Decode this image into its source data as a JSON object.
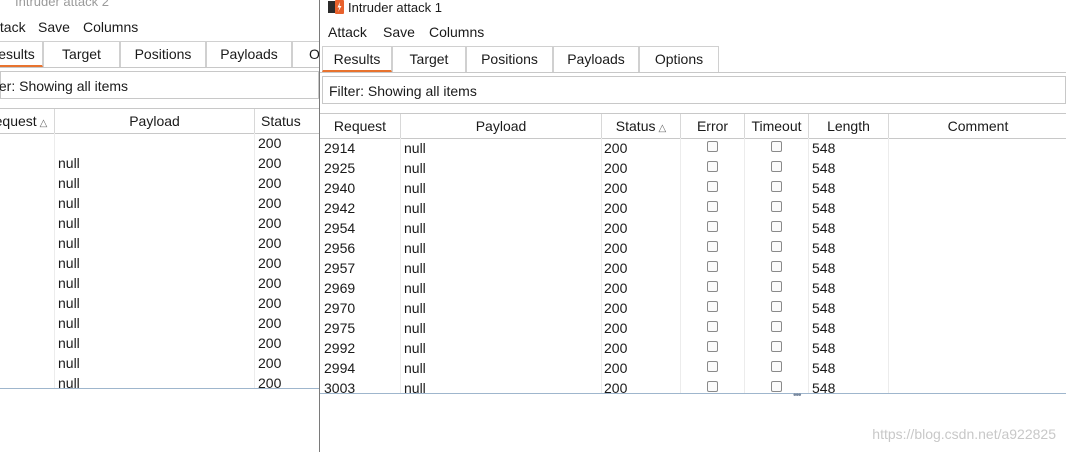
{
  "windowA": {
    "title": "Intruder attack 2",
    "menu": [
      "ttack",
      "Save",
      "Columns"
    ],
    "tabs": [
      "esults",
      "Target",
      "Positions",
      "Payloads",
      "O"
    ],
    "filter": "ter: Showing all items",
    "columns": [
      "equest",
      "Payload",
      "Status"
    ],
    "rows": [
      {
        "payload": "",
        "status": "200"
      },
      {
        "payload": "null",
        "status": "200"
      },
      {
        "payload": "null",
        "status": "200"
      },
      {
        "payload": "null",
        "status": "200"
      },
      {
        "payload": "null",
        "status": "200"
      },
      {
        "payload": "null",
        "status": "200"
      },
      {
        "payload": "null",
        "status": "200"
      },
      {
        "payload": "null",
        "status": "200"
      },
      {
        "payload": "null",
        "status": "200"
      },
      {
        "payload": "null",
        "status": "200"
      },
      {
        "payload": "null",
        "status": "200"
      },
      {
        "payload": "null",
        "status": "200"
      },
      {
        "payload": "null",
        "status": "200"
      }
    ]
  },
  "windowB": {
    "title": "Intruder attack 1",
    "menu": [
      "Attack",
      "Save",
      "Columns"
    ],
    "tabs": [
      "Results",
      "Target",
      "Positions",
      "Payloads",
      "Options"
    ],
    "filter": "Filter: Showing all items",
    "columns": [
      "Request",
      "Payload",
      "Status",
      "Error",
      "Timeout",
      "Length",
      "Comment"
    ],
    "rows": [
      {
        "request": "2914",
        "payload": "null",
        "status": "200",
        "error": false,
        "timeout": false,
        "length": "548"
      },
      {
        "request": "2925",
        "payload": "null",
        "status": "200",
        "error": false,
        "timeout": false,
        "length": "548"
      },
      {
        "request": "2940",
        "payload": "null",
        "status": "200",
        "error": false,
        "timeout": false,
        "length": "548"
      },
      {
        "request": "2942",
        "payload": "null",
        "status": "200",
        "error": false,
        "timeout": false,
        "length": "548"
      },
      {
        "request": "2954",
        "payload": "null",
        "status": "200",
        "error": false,
        "timeout": false,
        "length": "548"
      },
      {
        "request": "2956",
        "payload": "null",
        "status": "200",
        "error": false,
        "timeout": false,
        "length": "548"
      },
      {
        "request": "2957",
        "payload": "null",
        "status": "200",
        "error": false,
        "timeout": false,
        "length": "548"
      },
      {
        "request": "2969",
        "payload": "null",
        "status": "200",
        "error": false,
        "timeout": false,
        "length": "548"
      },
      {
        "request": "2970",
        "payload": "null",
        "status": "200",
        "error": false,
        "timeout": false,
        "length": "548"
      },
      {
        "request": "2975",
        "payload": "null",
        "status": "200",
        "error": false,
        "timeout": false,
        "length": "548"
      },
      {
        "request": "2992",
        "payload": "null",
        "status": "200",
        "error": false,
        "timeout": false,
        "length": "548"
      },
      {
        "request": "2994",
        "payload": "null",
        "status": "200",
        "error": false,
        "timeout": false,
        "length": "548"
      },
      {
        "request": "3003",
        "payload": "null",
        "status": "200",
        "error": false,
        "timeout": false,
        "length": "548"
      }
    ]
  },
  "watermark": "https://blog.csdn.net/a922825",
  "colors": {
    "tab_accent": "#e8732f",
    "app_icon": "#e8612c"
  }
}
